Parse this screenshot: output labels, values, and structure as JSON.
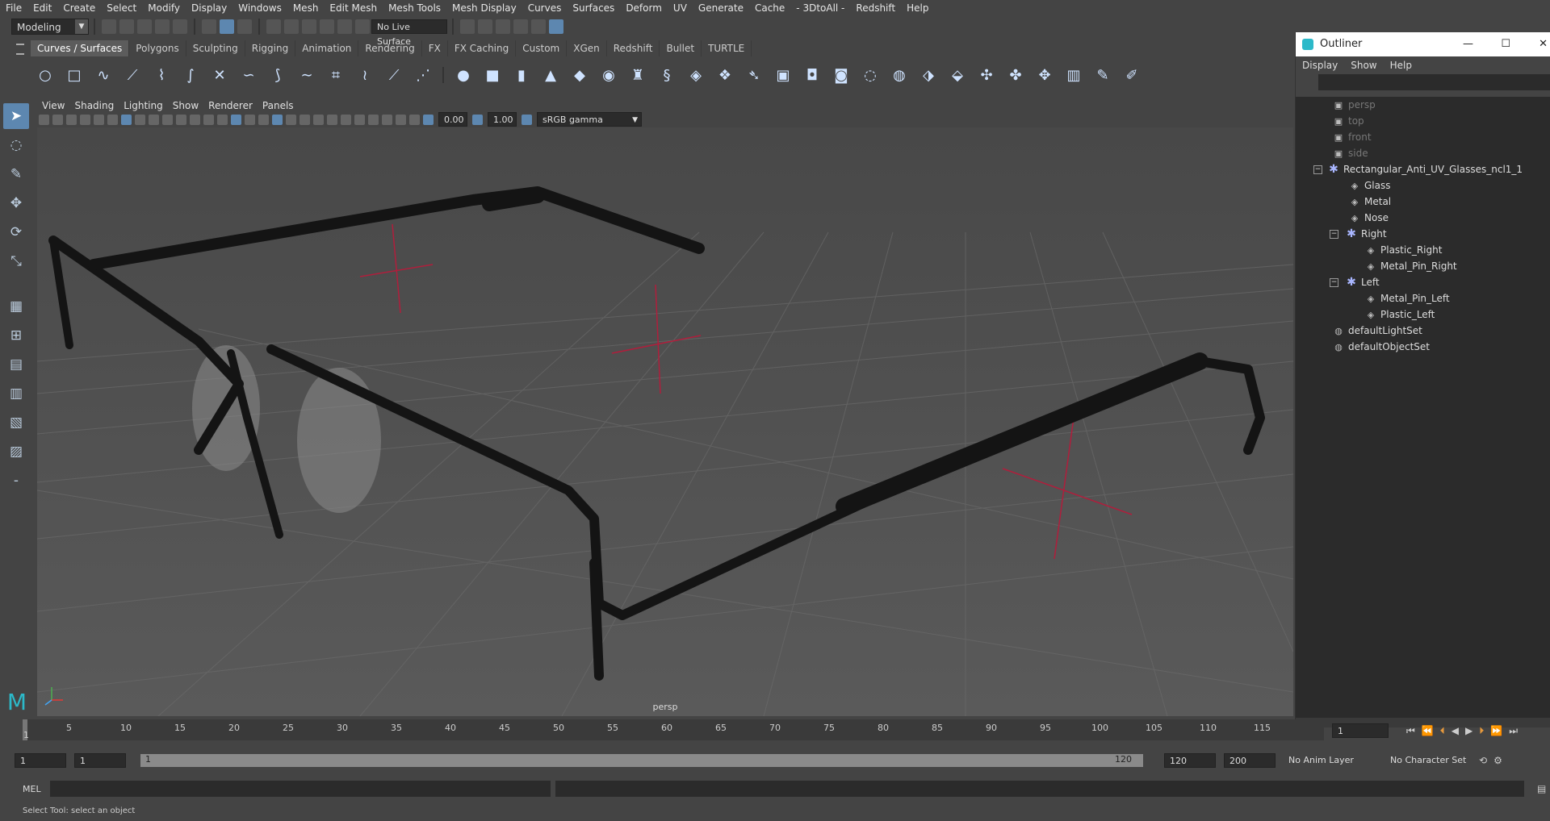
{
  "menubar": [
    "File",
    "Edit",
    "Create",
    "Select",
    "Modify",
    "Display",
    "Windows",
    "Mesh",
    "Edit Mesh",
    "Mesh Tools",
    "Mesh Display",
    "Curves",
    "Surfaces",
    "Deform",
    "UV",
    "Generate",
    "Cache",
    "- 3DtoAll -",
    "Redshift",
    "Help"
  ],
  "status": {
    "mode": "Modeling",
    "live_surface": "No Live Surface"
  },
  "shelf": {
    "tabs": [
      "Curves / Surfaces",
      "Polygons",
      "Sculpting",
      "Rigging",
      "Animation",
      "Rendering",
      "FX",
      "FX Caching",
      "Custom",
      "XGen",
      "Redshift",
      "Bullet",
      "TURTLE"
    ],
    "active_tab": 0
  },
  "viewport": {
    "menu": [
      "View",
      "Shading",
      "Lighting",
      "Show",
      "Renderer",
      "Panels"
    ],
    "exposure": "0.00",
    "gamma": "1.00",
    "color_space": "sRGB gamma",
    "camera": "persp"
  },
  "outliner": {
    "title": "Outliner",
    "menu": [
      "Display",
      "Show",
      "Help"
    ],
    "items": [
      {
        "label": "persp",
        "icon": "camera-icon",
        "dim": true
      },
      {
        "label": "top",
        "icon": "camera-icon",
        "dim": true
      },
      {
        "label": "front",
        "icon": "camera-icon",
        "dim": true
      },
      {
        "label": "side",
        "icon": "camera-icon",
        "dim": true
      },
      {
        "label": "Rectangular_Anti_UV_Glasses_ncl1_1",
        "icon": "group-icon",
        "dim": false
      },
      {
        "label": "Glass",
        "icon": "mesh-icon",
        "dim": false
      },
      {
        "label": "Metal",
        "icon": "mesh-icon",
        "dim": false
      },
      {
        "label": "Nose",
        "icon": "mesh-icon",
        "dim": false
      },
      {
        "label": "Right",
        "icon": "group-icon",
        "dim": false
      },
      {
        "label": "Plastic_Right",
        "icon": "mesh-icon",
        "dim": false
      },
      {
        "label": "Metal_Pin_Right",
        "icon": "mesh-icon",
        "dim": false
      },
      {
        "label": "Left",
        "icon": "group-icon",
        "dim": false
      },
      {
        "label": "Metal_Pin_Left",
        "icon": "mesh-icon",
        "dim": false
      },
      {
        "label": "Plastic_Left",
        "icon": "mesh-icon",
        "dim": false
      },
      {
        "label": "defaultLightSet",
        "icon": "set-icon",
        "dim": false
      },
      {
        "label": "defaultObjectSet",
        "icon": "set-icon",
        "dim": false
      }
    ]
  },
  "timeline": {
    "ticks": [
      "1",
      "5",
      "10",
      "15",
      "20",
      "25",
      "30",
      "35",
      "40",
      "45",
      "50",
      "55",
      "60",
      "65",
      "70",
      "75",
      "80",
      "85",
      "90",
      "95",
      "100",
      "105",
      "110",
      "115"
    ],
    "current_frame": "1"
  },
  "range": {
    "start": "1",
    "playback_start": "1",
    "slider_start": "1",
    "slider_end": "120",
    "playback_end": "120",
    "end": "200",
    "anim_layer": "No Anim Layer",
    "character_set": "No Character Set"
  },
  "command": {
    "label": "MEL"
  },
  "help_line": "Select Tool: select an object",
  "colors": {
    "accent": "#5d87b0",
    "background": "#444444",
    "locator": "#b01e3c"
  }
}
